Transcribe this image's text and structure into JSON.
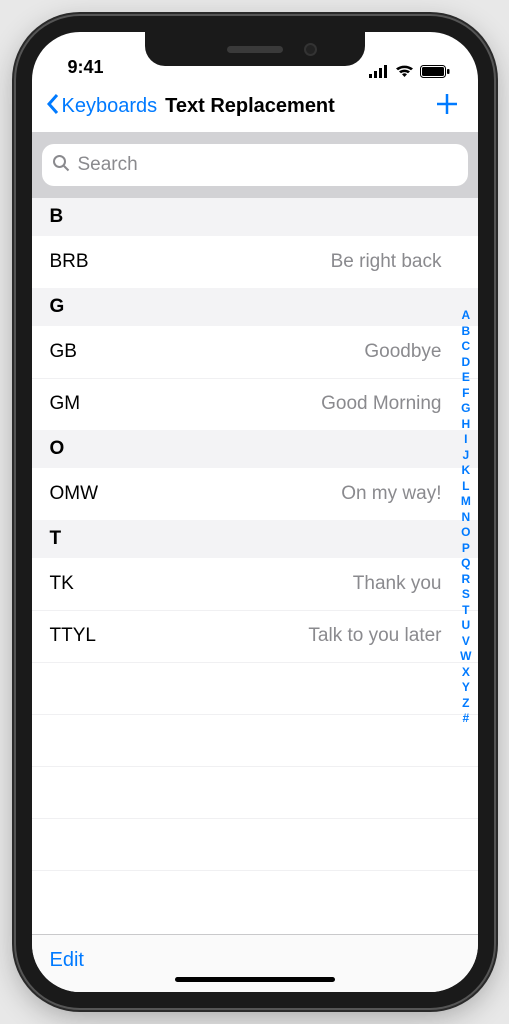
{
  "status": {
    "time": "9:41"
  },
  "nav": {
    "back": "Keyboards",
    "title": "Text Replacement"
  },
  "search": {
    "placeholder": "Search"
  },
  "sections": [
    {
      "letter": "B",
      "items": [
        {
          "shortcut": "BRB",
          "phrase": "Be right back"
        }
      ]
    },
    {
      "letter": "G",
      "items": [
        {
          "shortcut": "GB",
          "phrase": "Goodbye"
        },
        {
          "shortcut": "GM",
          "phrase": "Good Morning"
        }
      ]
    },
    {
      "letter": "O",
      "items": [
        {
          "shortcut": "OMW",
          "phrase": "On my way!"
        }
      ]
    },
    {
      "letter": "T",
      "items": [
        {
          "shortcut": "TK",
          "phrase": "Thank you"
        },
        {
          "shortcut": "TTYL",
          "phrase": "Talk to you later"
        }
      ]
    }
  ],
  "index": [
    "A",
    "B",
    "C",
    "D",
    "E",
    "F",
    "G",
    "H",
    "I",
    "J",
    "K",
    "L",
    "M",
    "N",
    "O",
    "P",
    "Q",
    "R",
    "S",
    "T",
    "U",
    "V",
    "W",
    "X",
    "Y",
    "Z",
    "#"
  ],
  "toolbar": {
    "edit": "Edit"
  }
}
